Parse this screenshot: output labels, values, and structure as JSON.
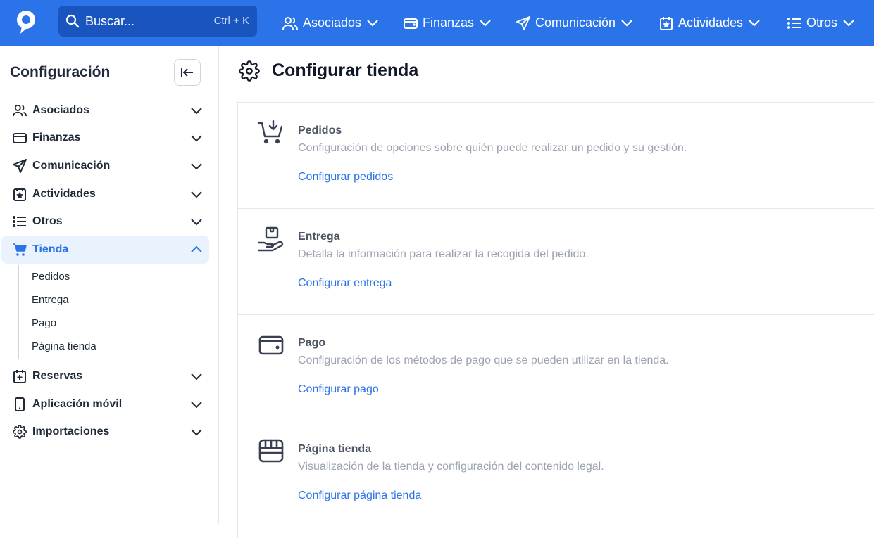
{
  "brand": {
    "accent": "#2b73e8",
    "topbar_bg": "#2b73e8",
    "search_bg": "#1a55bf",
    "logo": "app-logo"
  },
  "search": {
    "placeholder": "Buscar...",
    "shortcut": "Ctrl + K",
    "icon": "search-icon"
  },
  "topnav": [
    {
      "label": "Asociados",
      "icon": "users-icon"
    },
    {
      "label": "Finanzas",
      "icon": "wallet-icon"
    },
    {
      "label": "Comunicación",
      "icon": "send-icon"
    },
    {
      "label": "Actividades",
      "icon": "calendar-star-icon"
    },
    {
      "label": "Otros",
      "icon": "list-icon"
    }
  ],
  "sidebar": {
    "title": "Configuración",
    "items": [
      {
        "label": "Asociados",
        "icon": "users-icon"
      },
      {
        "label": "Finanzas",
        "icon": "wallet-icon"
      },
      {
        "label": "Comunicación",
        "icon": "send-icon"
      },
      {
        "label": "Actividades",
        "icon": "calendar-star-icon"
      },
      {
        "label": "Otros",
        "icon": "list-icon"
      },
      {
        "label": "Tienda",
        "icon": "cart-icon",
        "expanded": true
      },
      {
        "label": "Reservas",
        "icon": "calendar-plus-icon"
      },
      {
        "label": "Aplicación móvil",
        "icon": "smartphone-icon"
      },
      {
        "label": "Importaciones",
        "icon": "gear-icon"
      }
    ],
    "sub_items": [
      "Pedidos",
      "Entrega",
      "Pago",
      "Página tienda"
    ]
  },
  "main": {
    "title": "Configurar tienda",
    "cards": [
      {
        "title": "Pedidos",
        "description": "Configuración de opciones sobre quién puede realizar un pedido y su gestión.",
        "link": "Configurar pedidos",
        "icon": "cart-download-icon"
      },
      {
        "title": "Entrega",
        "description": "Detalla la información para realizar la recogida del pedido.",
        "link": "Configurar entrega",
        "icon": "hand-package-icon"
      },
      {
        "title": "Pago",
        "description": "Configuración de los métodos de pago que se pueden utilizar en la tienda.",
        "link": "Configurar pago",
        "icon": "wallet-icon"
      },
      {
        "title": "Página tienda",
        "description": "Visualización de la tienda y configuración del contenido legal.",
        "link": "Configurar página tienda",
        "icon": "storefront-icon"
      }
    ]
  }
}
